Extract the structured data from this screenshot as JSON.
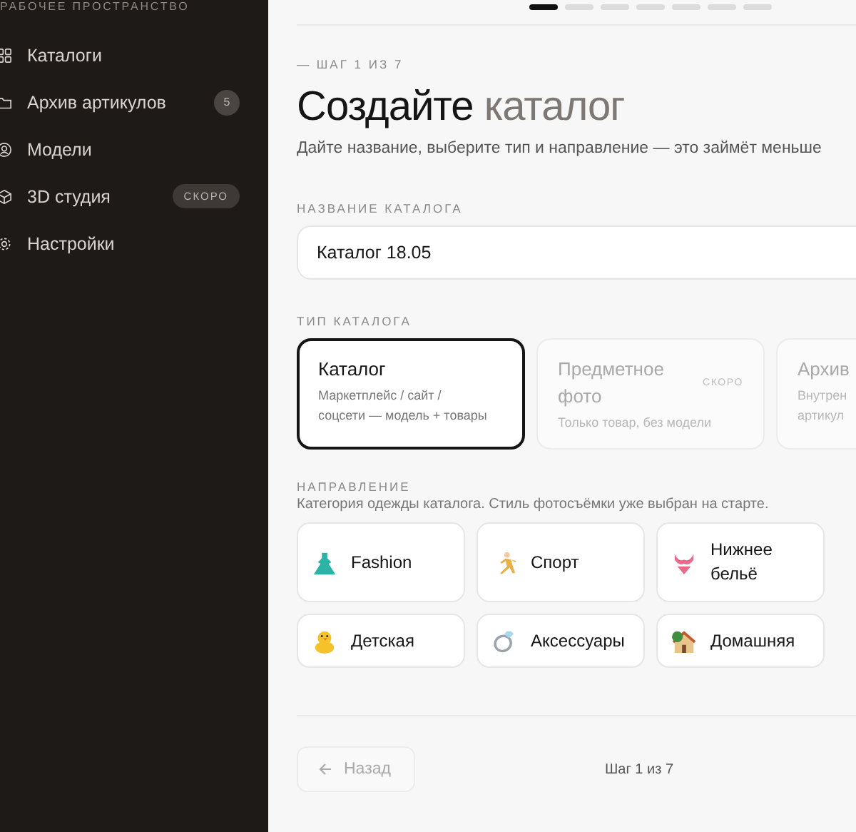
{
  "sidebar": {
    "section_label": "РАБОЧЕЕ ПРОСТРАНСТВО",
    "items": [
      {
        "label": "Каталоги"
      },
      {
        "label": "Архив артикулов",
        "count": "5"
      },
      {
        "label": "Модели"
      },
      {
        "label": "3D студия",
        "tag": "СКОРО"
      },
      {
        "label": "Настройки"
      }
    ]
  },
  "progress": {
    "steps": [
      {
        "selected": true
      },
      {
        "selected": false
      },
      {
        "selected": false
      },
      {
        "selected": false
      },
      {
        "selected": false
      },
      {
        "selected": false
      },
      {
        "selected": false
      }
    ]
  },
  "step_label": "— ШАГ 1 ИЗ 7",
  "title": {
    "main": "Создайте",
    "accent": "каталог"
  },
  "subtitle": "Дайте название, выберите тип и направление — это займёт меньше",
  "name_field": {
    "label": "НАЗВАНИЕ КАТАЛОГА",
    "value": "Каталог 18.05"
  },
  "catalog_type": {
    "label": "ТИП КАТАЛОГА",
    "options": [
      {
        "title": "Каталог",
        "description": [
          "Маркетплейс / сайт /",
          "соцсети — модель + товары"
        ],
        "selected": true,
        "disabled": false
      },
      {
        "title": "Предметное фото",
        "description": [
          "Только товар, без модели"
        ],
        "tag": "СКОРО",
        "selected": false,
        "disabled": true
      },
      {
        "title": "Архив",
        "description": [
          "Внутрен",
          "артикул"
        ],
        "selected": false,
        "disabled": true
      }
    ]
  },
  "direction": {
    "label": "НАПРАВЛЕНИЕ",
    "description": "Категория одежды каталога. Стиль фотосъёмки уже выбран на старте.",
    "options": [
      {
        "label": "Fashion",
        "selected": false
      },
      {
        "label": "Спорт",
        "selected": false
      },
      {
        "label": "Нижнее бельё",
        "selected": false
      },
      {
        "label": "Детская",
        "selected": false
      },
      {
        "label": "Аксессуары",
        "selected": false
      },
      {
        "label": "Домашняя",
        "selected": false
      }
    ]
  },
  "footer": {
    "back_button": {
      "label": "Назад",
      "disabled": true
    },
    "step_text": "Шаг 1 из 7"
  }
}
